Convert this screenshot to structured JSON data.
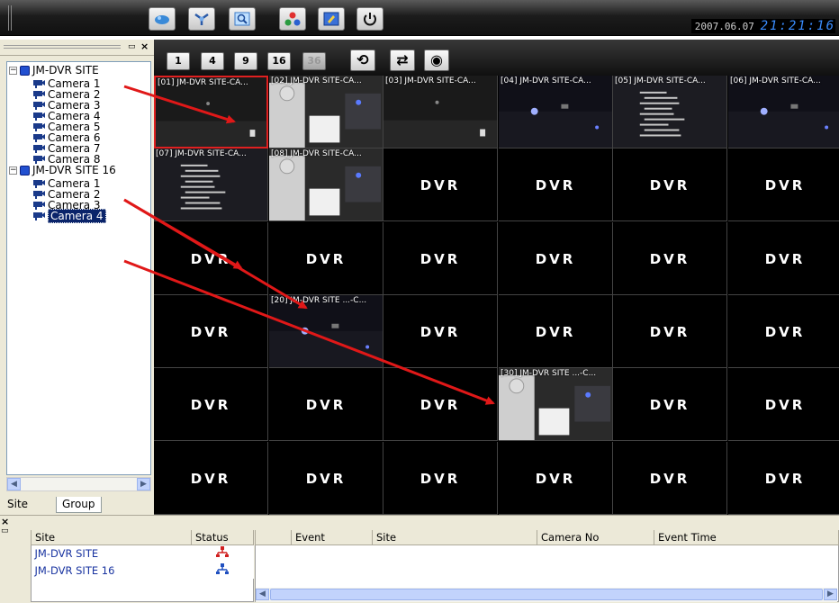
{
  "toolbar": {
    "buttons": [
      {
        "name": "dvr-icon"
      },
      {
        "name": "network-icon"
      },
      {
        "name": "search-icon"
      },
      {
        "name": "settings-icon"
      },
      {
        "name": "layout-icon"
      },
      {
        "name": "power-icon"
      }
    ],
    "date": "2007.06.07",
    "time": "21:21:16"
  },
  "tree": {
    "sites": [
      {
        "label": "JM-DVR SITE",
        "cameras": [
          "Camera 1",
          "Camera 2",
          "Camera 3",
          "Camera 4",
          "Camera 5",
          "Camera 6",
          "Camera 7",
          "Camera 8"
        ]
      },
      {
        "label": "JM-DVR SITE 16",
        "cameras": [
          "Camera 1",
          "Camera 2",
          "Camera 3",
          "Camera 4"
        ]
      }
    ],
    "selected": "Camera 4",
    "tabs": [
      "Site",
      "Group"
    ]
  },
  "viewbar": {
    "layouts": [
      "1",
      "4",
      "9",
      "16",
      "36"
    ],
    "actions": [
      "refresh-icon",
      "cycle-icon",
      "camera-icon"
    ]
  },
  "grid": {
    "placeholder": "DVR",
    "cells": [
      {
        "caption": "[01] JM-DVR SITE-CA...",
        "scene": "dark",
        "selected": true
      },
      {
        "caption": "[02] JM-DVR SITE-CA...",
        "scene": "lg"
      },
      {
        "caption": "[03] JM-DVR SITE-CA...",
        "scene": "dark"
      },
      {
        "caption": "[04] JM-DVR SITE-CA...",
        "scene": "room"
      },
      {
        "caption": "[05] JM-DVR SITE-CA...",
        "scene": "text"
      },
      {
        "caption": "[06] JM-DVR SITE-CA...",
        "scene": "room"
      },
      {
        "caption": "[07] JM-DVR SITE-CA...",
        "scene": "text"
      },
      {
        "caption": "[08] JM-DVR SITE-CA...",
        "scene": "lg"
      },
      {
        "caption": "",
        "scene": "dvr"
      },
      {
        "caption": "",
        "scene": "dvr"
      },
      {
        "caption": "",
        "scene": "dvr"
      },
      {
        "caption": "",
        "scene": "dvr"
      },
      {
        "caption": "",
        "scene": "dvr"
      },
      {
        "caption": "",
        "scene": "dvr"
      },
      {
        "caption": "",
        "scene": "dvr"
      },
      {
        "caption": "",
        "scene": "dvr"
      },
      {
        "caption": "",
        "scene": "dvr"
      },
      {
        "caption": "",
        "scene": "dvr"
      },
      {
        "caption": "",
        "scene": "dvr"
      },
      {
        "caption": "[20] JM-DVR SITE ...-C...",
        "scene": "room"
      },
      {
        "caption": "",
        "scene": "dvr"
      },
      {
        "caption": "",
        "scene": "dvr"
      },
      {
        "caption": "",
        "scene": "dvr"
      },
      {
        "caption": "",
        "scene": "dvr"
      },
      {
        "caption": "",
        "scene": "dvr"
      },
      {
        "caption": "",
        "scene": "dvr"
      },
      {
        "caption": "",
        "scene": "dvr"
      },
      {
        "caption": "[30] JM-DVR SITE ...-C...",
        "scene": "lg"
      },
      {
        "caption": "",
        "scene": "dvr"
      },
      {
        "caption": "",
        "scene": "dvr"
      },
      {
        "caption": "",
        "scene": "dvr"
      },
      {
        "caption": "",
        "scene": "dvr"
      },
      {
        "caption": "",
        "scene": "dvr"
      },
      {
        "caption": "",
        "scene": "dvr"
      },
      {
        "caption": "",
        "scene": "dvr"
      },
      {
        "caption": "",
        "scene": "dvr"
      }
    ]
  },
  "site_table": {
    "headers": [
      "Site",
      "Status"
    ],
    "rows": [
      {
        "site": "JM-DVR SITE",
        "status_color": "#d02020"
      },
      {
        "site": "JM-DVR SITE 16",
        "status_color": "#2050c0"
      }
    ]
  },
  "event_table": {
    "headers": [
      "",
      "Event",
      "Site",
      "Camera No",
      "Event Time"
    ]
  },
  "colors": {
    "arrow": "#e01818",
    "selection": "#e02020"
  }
}
